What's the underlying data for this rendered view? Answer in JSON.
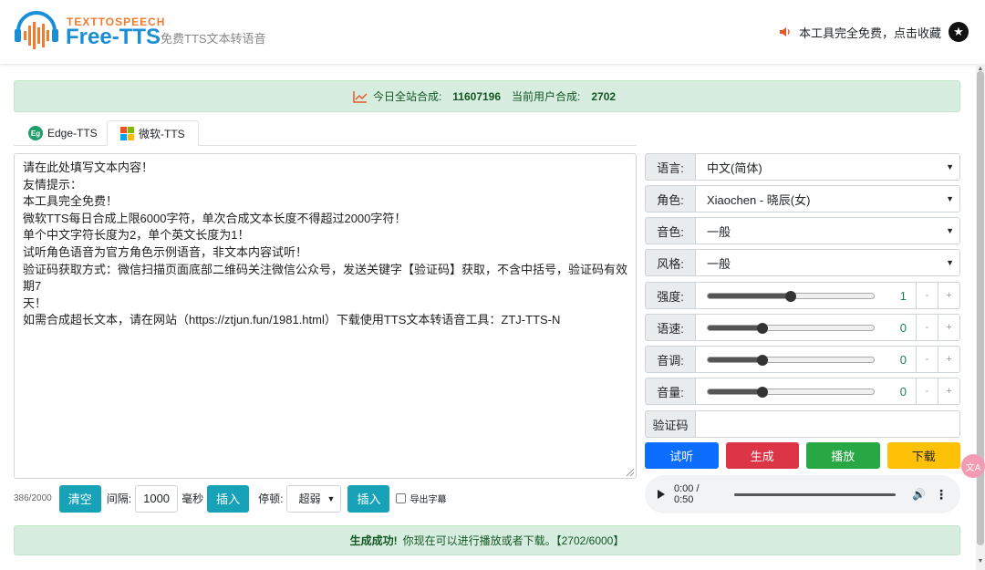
{
  "header": {
    "logo_sub": "TEXTTOSPEECH",
    "logo_main": "Free-TTS",
    "logo_desc": "免费TTS文本转语音",
    "notice": "本工具完全免费，点击收藏"
  },
  "stats": {
    "today_label": "今日全站合成:",
    "today_value": "11607196",
    "user_label": "当前用户合成:",
    "user_value": "2702"
  },
  "tabs": [
    {
      "label": "Edge-TTS",
      "icon": "edge-icon",
      "active": false
    },
    {
      "label": "微软-TTS",
      "icon": "microsoft-icon",
      "active": true
    }
  ],
  "editor": {
    "content": "请在此处填写文本内容！\n友情提示：\n本工具完全免费！\n微软TTS每日合成上限6000字符，单次合成文本长度不得超过2000字符！\n单个中文字符长度为2，单个英文长度为1！\n试听角色语音为官方角色示例语音，非文本内容试听！\n验证码获取方式：微信扫描页面底部二维码关注微信公众号，发送关键字【验证码】获取，不含中括号，验证码有效期7\n天！\n如需合成超长文本，请在网站（https://ztjun.fun/1981.html）下载使用TTS文本转语音工具：ZTJ-TTS-N",
    "char_count": "386/2000"
  },
  "toolbar": {
    "clear_label": "清空",
    "interval_label": "间隔:",
    "interval_value": "1000",
    "ms_label": "毫秒",
    "insert_label": "插入",
    "pause_label": "停顿:",
    "pause_value": "超弱",
    "insert2_label": "插入",
    "subtitle_label": "导出字幕"
  },
  "settings": {
    "language": {
      "label": "语言:",
      "value": "中文(简体)"
    },
    "role": {
      "label": "角色:",
      "value": "Xiaochen - 晓辰(女)"
    },
    "timbre": {
      "label": "音色:",
      "value": "一般"
    },
    "style": {
      "label": "风格:",
      "value": "一般"
    },
    "strength": {
      "label": "强度:",
      "value": "1",
      "level": 0.5
    },
    "speed": {
      "label": "语速:",
      "value": "0",
      "level": 0.33
    },
    "pitch": {
      "label": "音调:",
      "value": "0",
      "level": 0.33
    },
    "volume": {
      "label": "音量:",
      "value": "0",
      "level": 0.33
    },
    "captcha": {
      "label": "验证码"
    },
    "minus": "-",
    "plus": "+"
  },
  "actions": {
    "preview": "试听",
    "generate": "生成",
    "play": "播放",
    "download": "下载"
  },
  "player": {
    "time": "0:00 / 0:50"
  },
  "side_badge": "文A",
  "success": {
    "title": "生成成功!",
    "message": "你现在可以进行播放或者下载。【2702/6000】"
  },
  "colors": {
    "primary": "#0d6efd",
    "danger": "#dc3545",
    "success": "#28a745",
    "warning": "#ffc107",
    "info": "#17a2b8",
    "alert_bg": "#d6ede0"
  }
}
